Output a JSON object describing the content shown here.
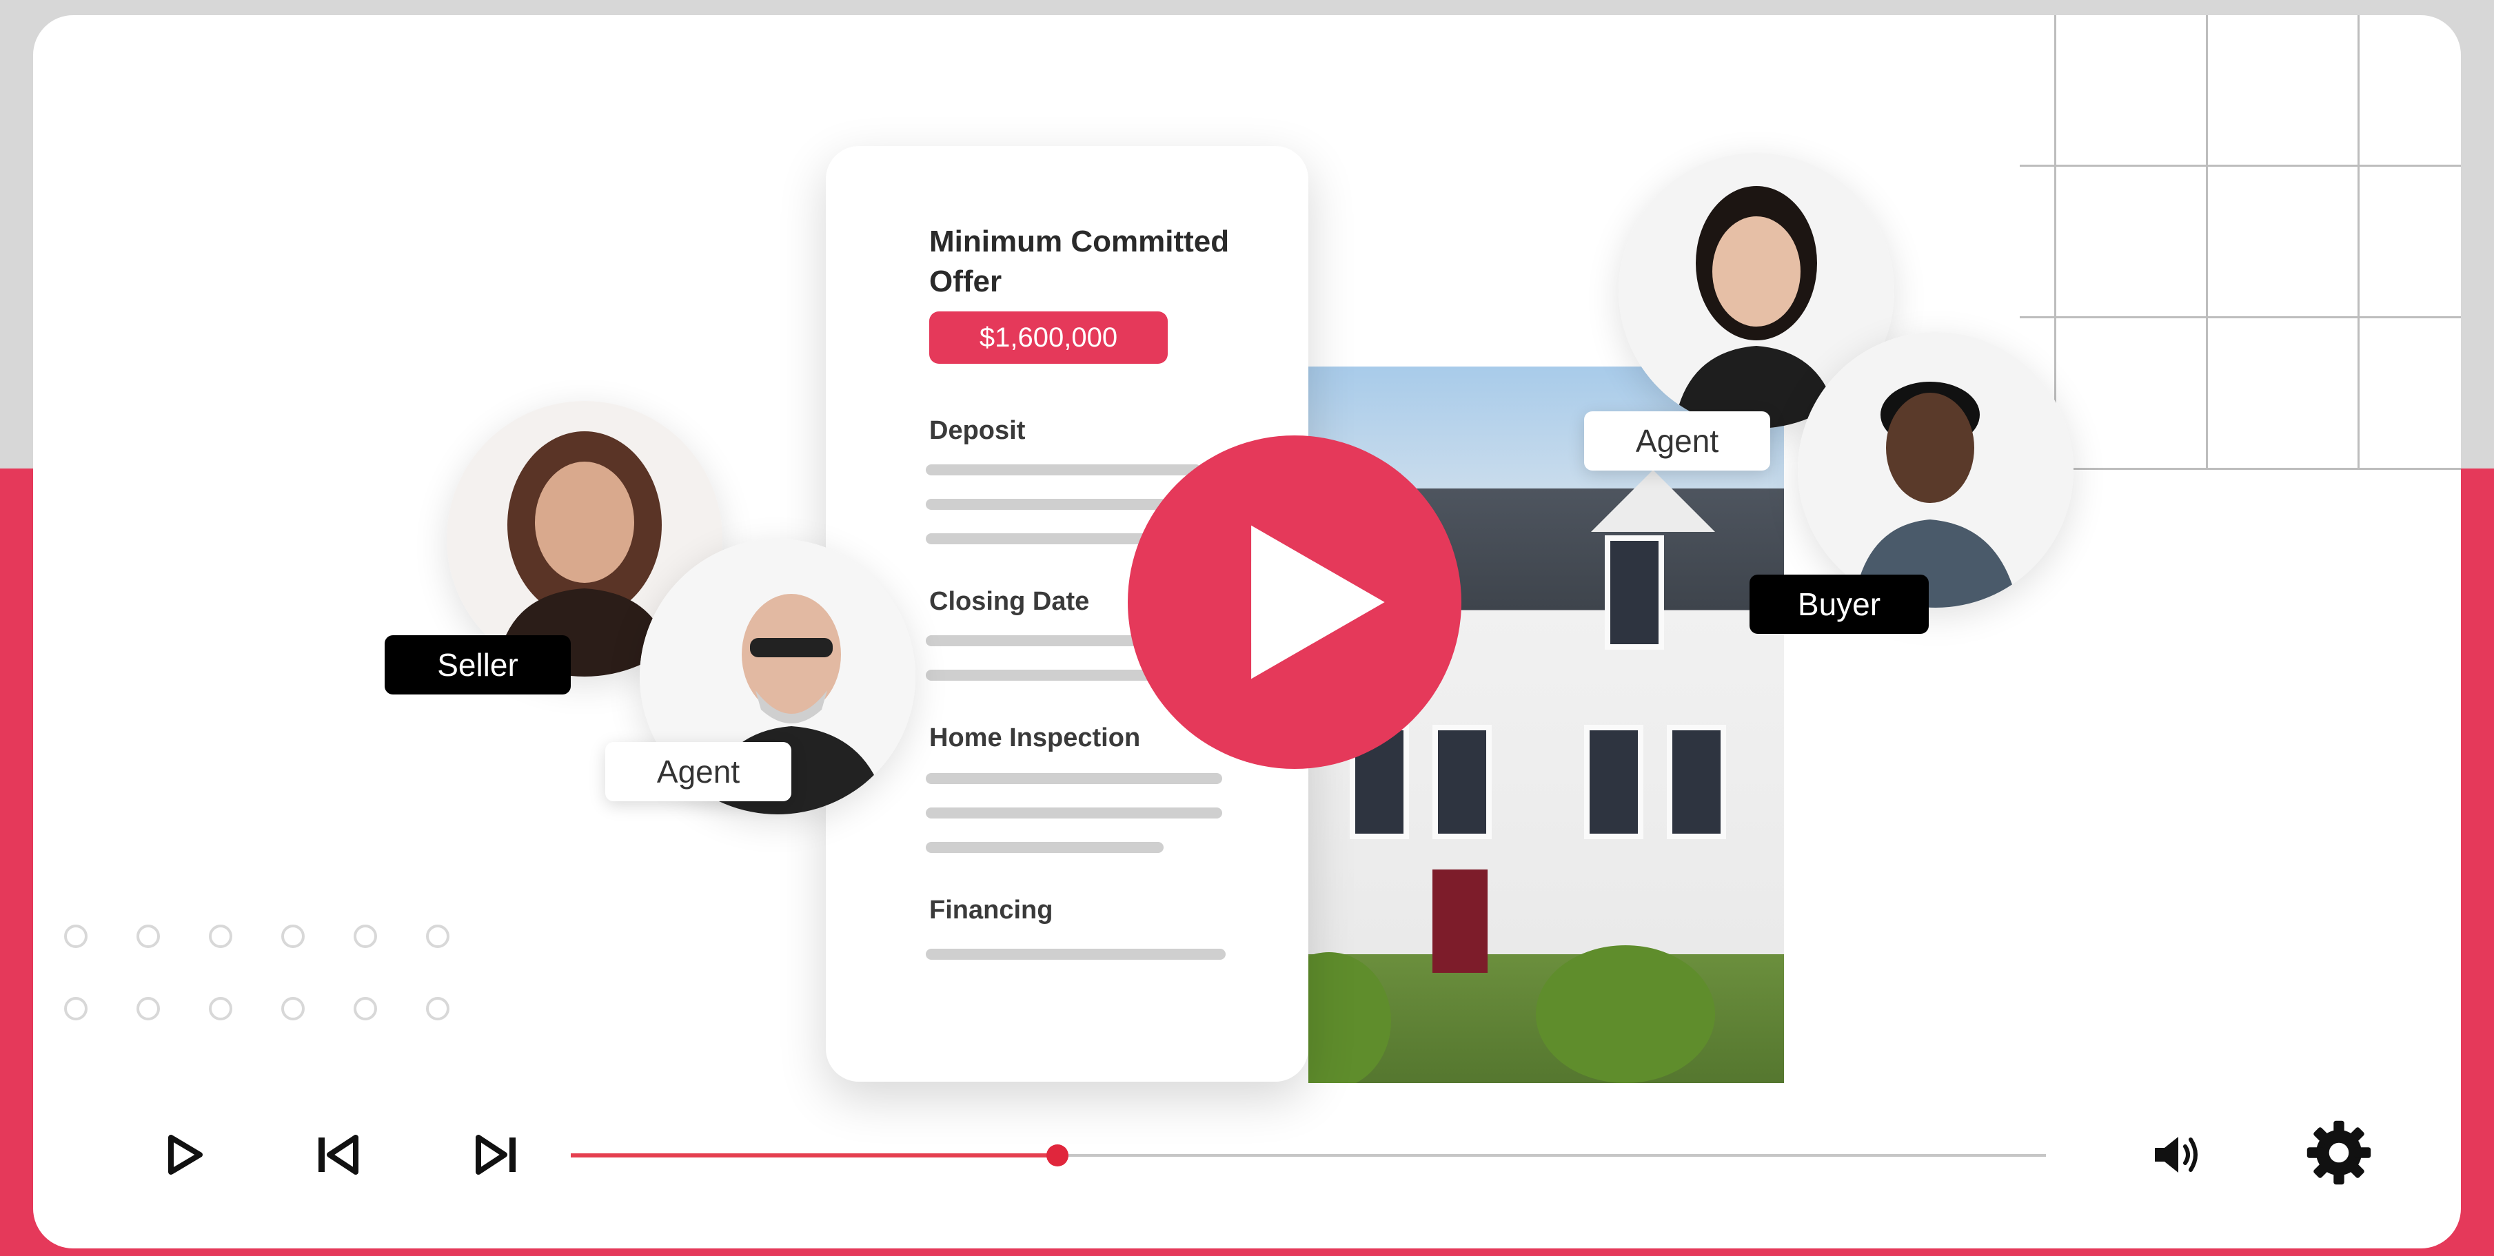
{
  "colors": {
    "accent": "#e5395a",
    "progress": "#e53f4f",
    "tag_dark": "#000000"
  },
  "offer_card": {
    "title": "Minimum Committed Offer",
    "amount": "$1,600,000",
    "sections": [
      {
        "label": "Deposit"
      },
      {
        "label": "Closing Date"
      },
      {
        "label": "Home Inspection"
      },
      {
        "label": "Financing"
      }
    ]
  },
  "people": {
    "seller_label": "Seller",
    "seller_agent_label": "Agent",
    "buyer_agent_label": "Agent",
    "buyer_label": "Buyer"
  },
  "player": {
    "big_play_icon": "play-circle-icon",
    "progress": 0.33,
    "controls": {
      "play": "play-icon",
      "previous": "skip-previous-icon",
      "next": "skip-next-icon",
      "volume": "volume-icon",
      "settings": "gear-icon"
    }
  }
}
